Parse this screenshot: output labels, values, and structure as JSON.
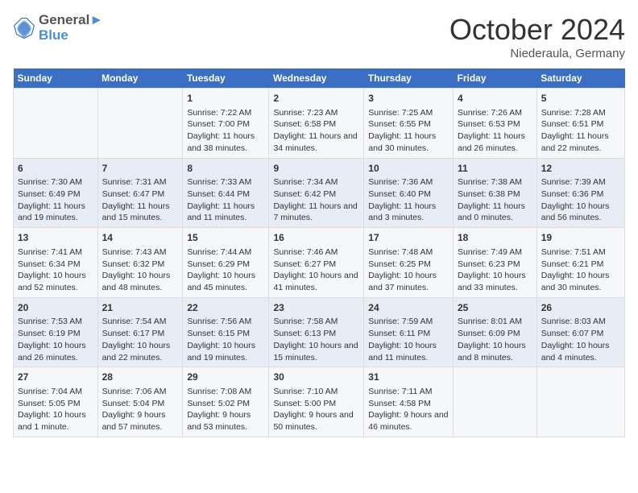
{
  "header": {
    "logo_line1": "General",
    "logo_line2": "Blue",
    "month": "October 2024",
    "location": "Niederaula, Germany"
  },
  "days_of_week": [
    "Sunday",
    "Monday",
    "Tuesday",
    "Wednesday",
    "Thursday",
    "Friday",
    "Saturday"
  ],
  "weeks": [
    [
      {
        "day": "",
        "info": ""
      },
      {
        "day": "",
        "info": ""
      },
      {
        "day": "1",
        "info": "Sunrise: 7:22 AM\nSunset: 7:00 PM\nDaylight: 11 hours and 38 minutes."
      },
      {
        "day": "2",
        "info": "Sunrise: 7:23 AM\nSunset: 6:58 PM\nDaylight: 11 hours and 34 minutes."
      },
      {
        "day": "3",
        "info": "Sunrise: 7:25 AM\nSunset: 6:55 PM\nDaylight: 11 hours and 30 minutes."
      },
      {
        "day": "4",
        "info": "Sunrise: 7:26 AM\nSunset: 6:53 PM\nDaylight: 11 hours and 26 minutes."
      },
      {
        "day": "5",
        "info": "Sunrise: 7:28 AM\nSunset: 6:51 PM\nDaylight: 11 hours and 22 minutes."
      }
    ],
    [
      {
        "day": "6",
        "info": "Sunrise: 7:30 AM\nSunset: 6:49 PM\nDaylight: 11 hours and 19 minutes."
      },
      {
        "day": "7",
        "info": "Sunrise: 7:31 AM\nSunset: 6:47 PM\nDaylight: 11 hours and 15 minutes."
      },
      {
        "day": "8",
        "info": "Sunrise: 7:33 AM\nSunset: 6:44 PM\nDaylight: 11 hours and 11 minutes."
      },
      {
        "day": "9",
        "info": "Sunrise: 7:34 AM\nSunset: 6:42 PM\nDaylight: 11 hours and 7 minutes."
      },
      {
        "day": "10",
        "info": "Sunrise: 7:36 AM\nSunset: 6:40 PM\nDaylight: 11 hours and 3 minutes."
      },
      {
        "day": "11",
        "info": "Sunrise: 7:38 AM\nSunset: 6:38 PM\nDaylight: 11 hours and 0 minutes."
      },
      {
        "day": "12",
        "info": "Sunrise: 7:39 AM\nSunset: 6:36 PM\nDaylight: 10 hours and 56 minutes."
      }
    ],
    [
      {
        "day": "13",
        "info": "Sunrise: 7:41 AM\nSunset: 6:34 PM\nDaylight: 10 hours and 52 minutes."
      },
      {
        "day": "14",
        "info": "Sunrise: 7:43 AM\nSunset: 6:32 PM\nDaylight: 10 hours and 48 minutes."
      },
      {
        "day": "15",
        "info": "Sunrise: 7:44 AM\nSunset: 6:29 PM\nDaylight: 10 hours and 45 minutes."
      },
      {
        "day": "16",
        "info": "Sunrise: 7:46 AM\nSunset: 6:27 PM\nDaylight: 10 hours and 41 minutes."
      },
      {
        "day": "17",
        "info": "Sunrise: 7:48 AM\nSunset: 6:25 PM\nDaylight: 10 hours and 37 minutes."
      },
      {
        "day": "18",
        "info": "Sunrise: 7:49 AM\nSunset: 6:23 PM\nDaylight: 10 hours and 33 minutes."
      },
      {
        "day": "19",
        "info": "Sunrise: 7:51 AM\nSunset: 6:21 PM\nDaylight: 10 hours and 30 minutes."
      }
    ],
    [
      {
        "day": "20",
        "info": "Sunrise: 7:53 AM\nSunset: 6:19 PM\nDaylight: 10 hours and 26 minutes."
      },
      {
        "day": "21",
        "info": "Sunrise: 7:54 AM\nSunset: 6:17 PM\nDaylight: 10 hours and 22 minutes."
      },
      {
        "day": "22",
        "info": "Sunrise: 7:56 AM\nSunset: 6:15 PM\nDaylight: 10 hours and 19 minutes."
      },
      {
        "day": "23",
        "info": "Sunrise: 7:58 AM\nSunset: 6:13 PM\nDaylight: 10 hours and 15 minutes."
      },
      {
        "day": "24",
        "info": "Sunrise: 7:59 AM\nSunset: 6:11 PM\nDaylight: 10 hours and 11 minutes."
      },
      {
        "day": "25",
        "info": "Sunrise: 8:01 AM\nSunset: 6:09 PM\nDaylight: 10 hours and 8 minutes."
      },
      {
        "day": "26",
        "info": "Sunrise: 8:03 AM\nSunset: 6:07 PM\nDaylight: 10 hours and 4 minutes."
      }
    ],
    [
      {
        "day": "27",
        "info": "Sunrise: 7:04 AM\nSunset: 5:05 PM\nDaylight: 10 hours and 1 minute."
      },
      {
        "day": "28",
        "info": "Sunrise: 7:06 AM\nSunset: 5:04 PM\nDaylight: 9 hours and 57 minutes."
      },
      {
        "day": "29",
        "info": "Sunrise: 7:08 AM\nSunset: 5:02 PM\nDaylight: 9 hours and 53 minutes."
      },
      {
        "day": "30",
        "info": "Sunrise: 7:10 AM\nSunset: 5:00 PM\nDaylight: 9 hours and 50 minutes."
      },
      {
        "day": "31",
        "info": "Sunrise: 7:11 AM\nSunset: 4:58 PM\nDaylight: 9 hours and 46 minutes."
      },
      {
        "day": "",
        "info": ""
      },
      {
        "day": "",
        "info": ""
      }
    ]
  ]
}
